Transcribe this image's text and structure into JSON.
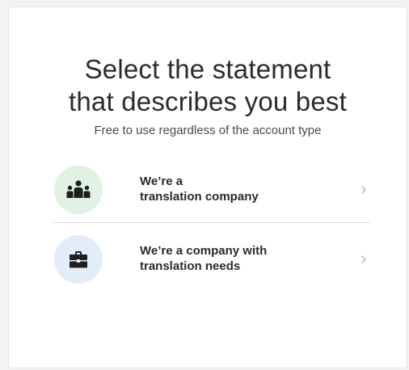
{
  "header": {
    "title_line1": "Select the statement",
    "title_line2": "that describes you best",
    "subtitle": "Free to use regardless of the account type"
  },
  "options": [
    {
      "icon": "team-icon",
      "line1": "We’re a",
      "line2": "translation company",
      "icon_bg": "#dff2e4"
    },
    {
      "icon": "briefcase-icon",
      "line1": "We’re a company with",
      "line2": "translation needs",
      "icon_bg": "#e3ecfb"
    }
  ],
  "colors": {
    "text": "#2b2b2b",
    "chevron": "#b5b5b5",
    "divider": "#d9d9d9",
    "icon": "#1f1f1f"
  }
}
